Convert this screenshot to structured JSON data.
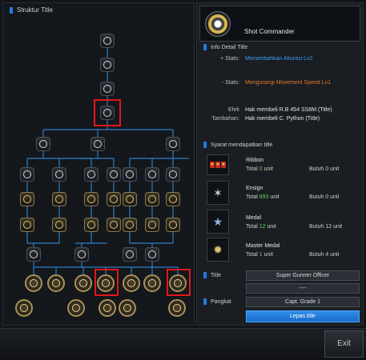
{
  "left": {
    "title": "Struktur Title"
  },
  "header": {
    "title": "Shot Commander"
  },
  "info": {
    "section": "Info Detail Title",
    "plus_label": "+ Stats:",
    "plus_value": "Menambahkan Akurasi Lv2",
    "minus_label": "- Stats:",
    "minus_value": "Mengurangi Movement Speed Lv1",
    "effect_label_1": "Efek",
    "effect_label_2": "Tambahan:",
    "effect_value_1": "Hak membeli R.B 454 SS8M (Title)",
    "effect_value_2": "Hak membeli C. Python (Title)"
  },
  "requirements": {
    "section": "Syarat mendapatkan title",
    "items": [
      {
        "name": "Ribbon",
        "total_prefix": "Total",
        "total_count": "0",
        "total_unit": "unit",
        "need": "Butuh 0 unit"
      },
      {
        "name": "Ensign",
        "total_prefix": "Total",
        "total_count": "893",
        "total_unit": "unit",
        "need": "Butuh 0 unit"
      },
      {
        "name": "Medal",
        "total_prefix": "Total",
        "total_count": "12",
        "total_unit": "unit",
        "need": "Butuh 12 unit"
      },
      {
        "name": "Master Medal",
        "total_prefix": "Total",
        "total_count": "1",
        "total_unit": "unit",
        "need": "Butuh 4 unit"
      }
    ]
  },
  "title_section": {
    "label": "Title",
    "value1": "Super Gunner Officer",
    "value2": "----"
  },
  "rank_section": {
    "label": "Pangkat",
    "value": "Capt. Grade 1"
  },
  "buttons": {
    "release": "Lepas title",
    "exit": "Exit"
  },
  "colors": {
    "accent": "#1e7be0",
    "selection": "#e01818",
    "positive": "#3a9ef0",
    "negative": "#e07a2a",
    "count": "#5fd35f"
  }
}
